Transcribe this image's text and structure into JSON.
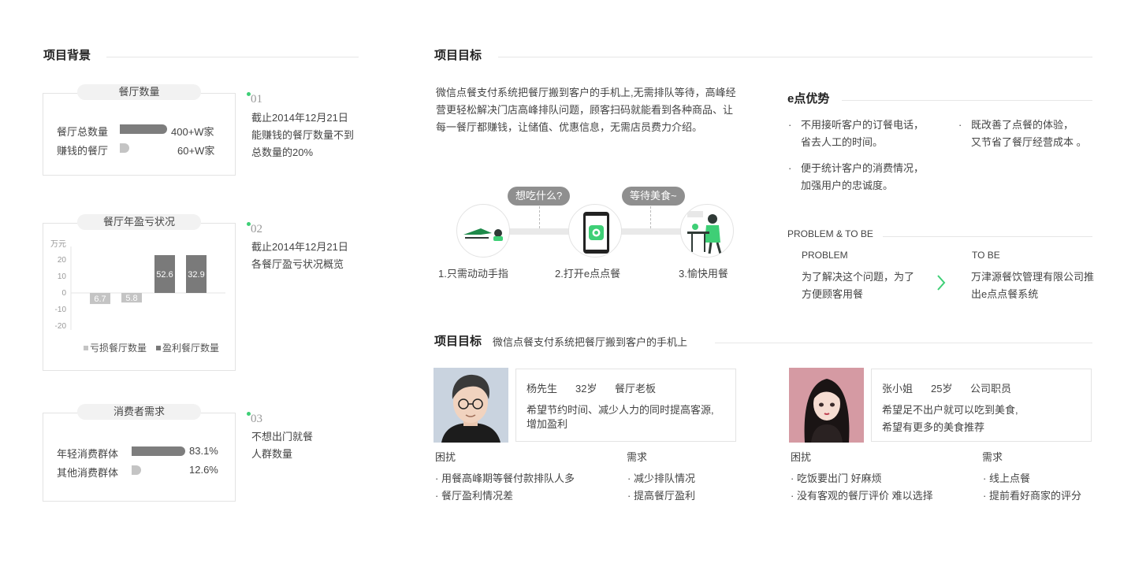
{
  "background": {
    "title": "项目背景",
    "restaurant_count": {
      "pill": "餐厅数量",
      "rows": [
        {
          "label": "餐厅总数量",
          "value": "400+W家",
          "fill": 1.0
        },
        {
          "label": "赚钱的餐厅",
          "value": "60+W家",
          "fill": 0.15
        }
      ],
      "num": "01",
      "note": [
        "截止2014年12月21日",
        "能赚钱的餐厅数量不到",
        "总数量的20%"
      ]
    },
    "profit_loss": {
      "pill": "餐厅年盈亏状况",
      "num": "02",
      "note": [
        "截止2014年12月21日",
        "各餐厅盈亏状况概览"
      ]
    },
    "consumer": {
      "pill": "消费者需求",
      "rows": [
        {
          "label": "年轻消费群体",
          "value": "83.1%",
          "fill": 0.831
        },
        {
          "label": "其他消费群体",
          "value": "12.6%",
          "fill": 0.126
        }
      ],
      "num": "03",
      "note": [
        "不想出门就餐",
        "人群数量"
      ]
    }
  },
  "chart_data": {
    "type": "bar",
    "ylabel": "万元",
    "ylim": [
      -20,
      20
    ],
    "yticks": [
      "20",
      "10",
      "0",
      "-10",
      "-20"
    ],
    "series": [
      {
        "name": "亏损餐厅数量",
        "color": "#c4c4c4",
        "values": [
          -6.7,
          -5.8
        ],
        "labels": [
          "6.7",
          "5.8"
        ]
      },
      {
        "name": "盈利餐厅数量",
        "color": "#7a7a7a",
        "values": [
          52.6,
          32.9
        ],
        "labels": [
          "52.6",
          "32.9"
        ]
      }
    ]
  },
  "goal": {
    "title": "项目目标",
    "intro": "微信点餐支付系统把餐厅搬到客户的手机上,无需排队等待，高峰经营更轻松解决门店高峰排队问题，顾客扫码就能看到各种商品、让每一餐厅都赚钱，让储值、优惠信息，无需店员费力介绍。",
    "bubbles": [
      "想吃什么?",
      "等待美食~"
    ],
    "steps": [
      "1.只需动动手指",
      "2.打开e点点餐",
      "3.愉快用餐"
    ]
  },
  "advantage": {
    "title": "e点优势",
    "items": [
      [
        "不用接听客户的订餐电话，",
        "省去人工的时间。"
      ],
      [
        "既改善了点餐的体验，",
        "又节省了餐厅经营成本 。"
      ],
      [
        "便于统计客户的消费情况，",
        "加强用户的忠诚度。"
      ]
    ],
    "problem_heading": "PROBLEM & TO BE",
    "problem_label": "PROBLEM",
    "problem_text": "为了解决这个问题，为了方便顾客用餐",
    "tobe_label": "TO BE",
    "tobe_text": "万津源餐饮管理有限公司推出e点点餐系统",
    "arrow_color": "#3ecf76"
  },
  "personas": {
    "title": "项目目标",
    "subtitle": "微信点餐支付系统把餐厅搬到客户的手机上",
    "list": [
      {
        "name": "杨先生",
        "age": "32岁",
        "job": "餐厅老板",
        "desc": [
          "希望节约时间、减少人力的同时提高客源,",
          "增加盈利"
        ],
        "pain_label": "困扰",
        "pains": [
          "用餐高峰期等餐付款排队人多",
          "餐厅盈利情况差"
        ],
        "need_label": "需求",
        "needs": [
          "减少排队情况",
          "提高餐厅盈利"
        ]
      },
      {
        "name": "张小姐",
        "age": "25岁",
        "job": "公司职员",
        "desc": [
          "希望足不出户就可以吃到美食,",
          "希望有更多的美食推荐"
        ],
        "pain_label": "困扰",
        "pains": [
          "吃饭要出门 好麻烦",
          "没有客观的餐厅评价 难以选择"
        ],
        "need_label": "需求",
        "needs": [
          "线上点餐",
          "提前看好商家的评分"
        ]
      }
    ]
  }
}
